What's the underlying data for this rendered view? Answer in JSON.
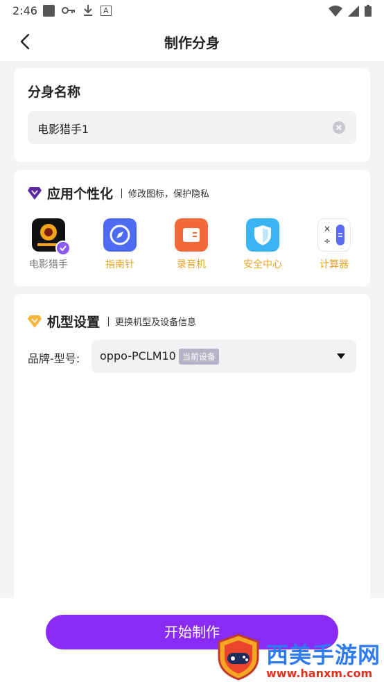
{
  "status_bar": {
    "time": "2:46",
    "icon_a": "A"
  },
  "app_bar": {
    "title": "制作分身"
  },
  "clone_name": {
    "title": "分身名称",
    "value": "电影猎手1"
  },
  "personalize": {
    "title": "应用个性化",
    "subtitle": "修改图标，保护隐私",
    "icons": [
      {
        "label": "电影猎手",
        "icon": "movie-app-icon",
        "selected": true
      },
      {
        "label": "指南针",
        "icon": "compass-icon"
      },
      {
        "label": "录音机",
        "icon": "recorder-icon"
      },
      {
        "label": "安全中心",
        "icon": "shield-icon"
      },
      {
        "label": "计算器",
        "icon": "calculator-icon"
      }
    ]
  },
  "device_settings": {
    "title": "机型设置",
    "subtitle": "更换机型及设备信息",
    "brand_label": "品牌-型号:",
    "brand_value": "oppo-PCLM10",
    "current_tag": "当前设备"
  },
  "actions": {
    "start_label": "开始制作"
  },
  "watermark": {
    "text": "西美手游网",
    "url": "www.hanxm.com"
  },
  "colors": {
    "accent": "#8a2bf3",
    "label_orange": "#e8a325",
    "check": "#8a5cf5"
  }
}
